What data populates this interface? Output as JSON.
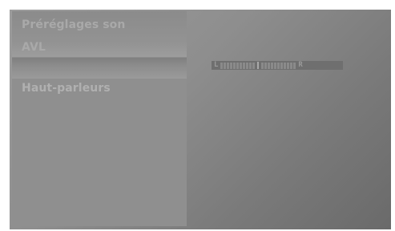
{
  "menu": {
    "items": [
      {
        "label": "Préréglages son"
      },
      {
        "label": "AVL"
      },
      {
        "label": "Haut-parleurs"
      }
    ]
  },
  "balance": {
    "left_label": "L",
    "right_label": "R",
    "ticks_left": 11,
    "ticks_right": 11
  }
}
